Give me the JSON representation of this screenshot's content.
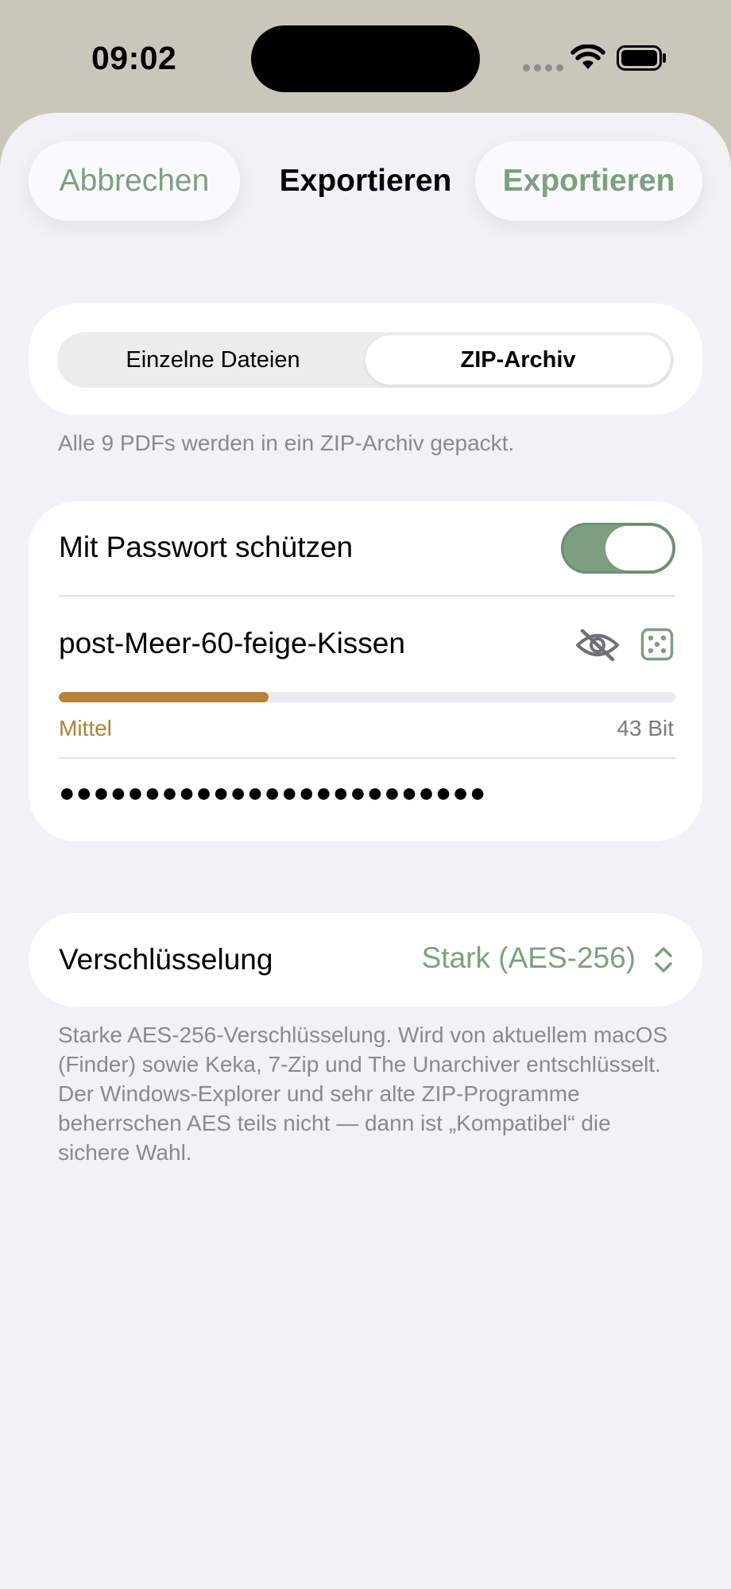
{
  "status_bar": {
    "time": "09:02"
  },
  "nav": {
    "cancel_label": "Abbrechen",
    "title": "Exportieren",
    "export_label": "Exportieren"
  },
  "export_mode": {
    "options": [
      "Einzelne Dateien",
      "ZIP-Archiv"
    ],
    "selected": "ZIP-Archiv",
    "hint": "Alle 9 PDFs werden in ein ZIP-Archiv gepackt."
  },
  "password": {
    "protect_label": "Mit Passwort schützen",
    "protect_enabled": true,
    "value": "post-Meer-60-feige-Kissen",
    "strength_label": "Mittel",
    "strength_fraction": 0.34,
    "bits_label": "43 Bit",
    "confirm_masked": "●●●●●●●●●●●●●●●●●●●●●●●●●",
    "icons": [
      "eye-slash-icon",
      "dice-icon"
    ]
  },
  "encryption": {
    "label": "Verschlüsselung",
    "value": "Stark (AES-256)",
    "hint": "Starke AES-256-Verschlüsselung. Wird von aktuellem macOS (Finder) sowie Keka, 7-Zip und The Unarchiver entschlüsselt. Der Windows-Explorer und sehr alte ZIP-Programme beherrschen AES teils nicht — dann ist „Kompatibel“ die sichere Wahl."
  },
  "colors": {
    "accent_green": "#7da07f",
    "strength_orange": "#b68338",
    "sheet_background": "#f2f2f6"
  }
}
